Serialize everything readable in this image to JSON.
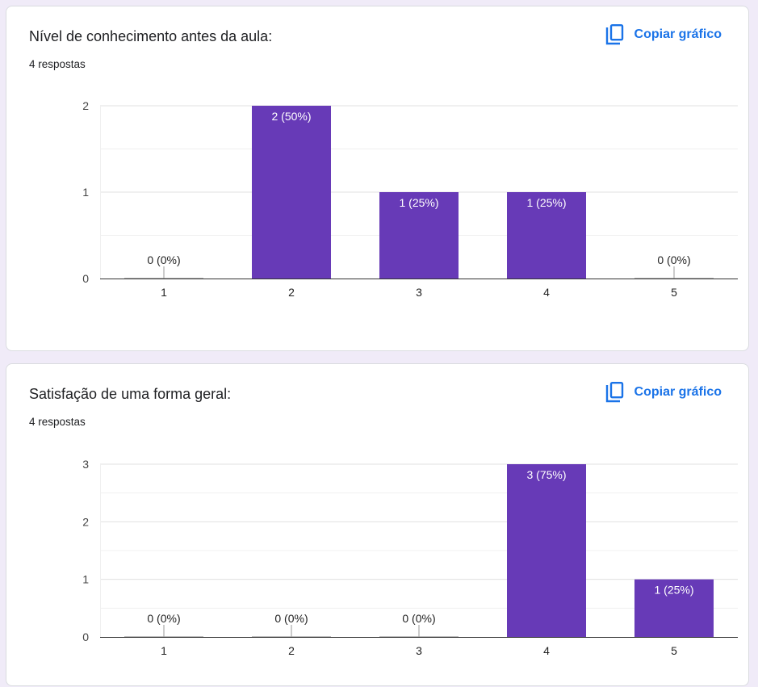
{
  "cards": [
    {
      "title": "Nível de conhecimento antes da aula:",
      "responses": "4 respostas",
      "copy_label": "Copiar gráfico",
      "copy_icon": "copy-icon"
    },
    {
      "title": "Satisfação de uma forma geral:",
      "responses": "4 respostas",
      "copy_label": "Copiar gráfico",
      "copy_icon": "copy-icon"
    }
  ],
  "colors": {
    "bar": "#673ab7",
    "accent": "#1a73e8",
    "background": "#f0ebf8"
  },
  "chart_data": [
    {
      "type": "bar",
      "title": "Nível de conhecimento antes da aula:",
      "categories": [
        "1",
        "2",
        "3",
        "4",
        "5"
      ],
      "values": [
        0,
        2,
        1,
        1,
        0
      ],
      "labels": [
        "0 (0%)",
        "2 (50%)",
        "1 (25%)",
        "1 (25%)",
        "0 (0%)"
      ],
      "yticks": [
        "0",
        "1",
        "2"
      ],
      "ylim": [
        0,
        2
      ],
      "grid": true
    },
    {
      "type": "bar",
      "title": "Satisfação de uma forma geral:",
      "categories": [
        "1",
        "2",
        "3",
        "4",
        "5"
      ],
      "values": [
        0,
        0,
        0,
        3,
        1
      ],
      "labels": [
        "0 (0%)",
        "0 (0%)",
        "0 (0%)",
        "3 (75%)",
        "1 (25%)"
      ],
      "yticks": [
        "0",
        "1",
        "2",
        "3"
      ],
      "ylim": [
        0,
        3
      ],
      "grid": true
    }
  ]
}
